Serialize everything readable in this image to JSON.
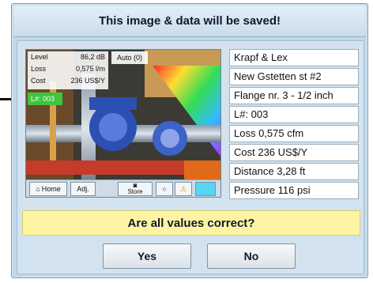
{
  "dialog": {
    "title": "This image & data will be saved!",
    "question": "Are all values correct?",
    "yes_label": "Yes",
    "no_label": "No"
  },
  "overlay": {
    "level_label": "Level",
    "level_value": "86,2 dB",
    "loss_label": "Loss",
    "loss_value": "0,575 l/m",
    "cost_label": "Cost",
    "cost_value": "236 US$/Y",
    "mode": "Auto (0)",
    "leak_number": "L#: 003"
  },
  "photo_toolbar": {
    "home_label": "Home",
    "adj_label": "Adj.",
    "store_label": "Store"
  },
  "info": [
    "Krapf & Lex",
    "New Gstetten st #2",
    "Flange nr. 3 - 1/2 inch",
    "L#: 003",
    "Loss 0,575 cfm",
    "Cost 236 US$/Y",
    "Distance 3,28 ft",
    "Pressure 116 psi"
  ],
  "colors": {
    "dialog_bg": "#bfd8ea",
    "question_bg": "#fdf4a3",
    "leak_badge": "#3fc43f"
  }
}
